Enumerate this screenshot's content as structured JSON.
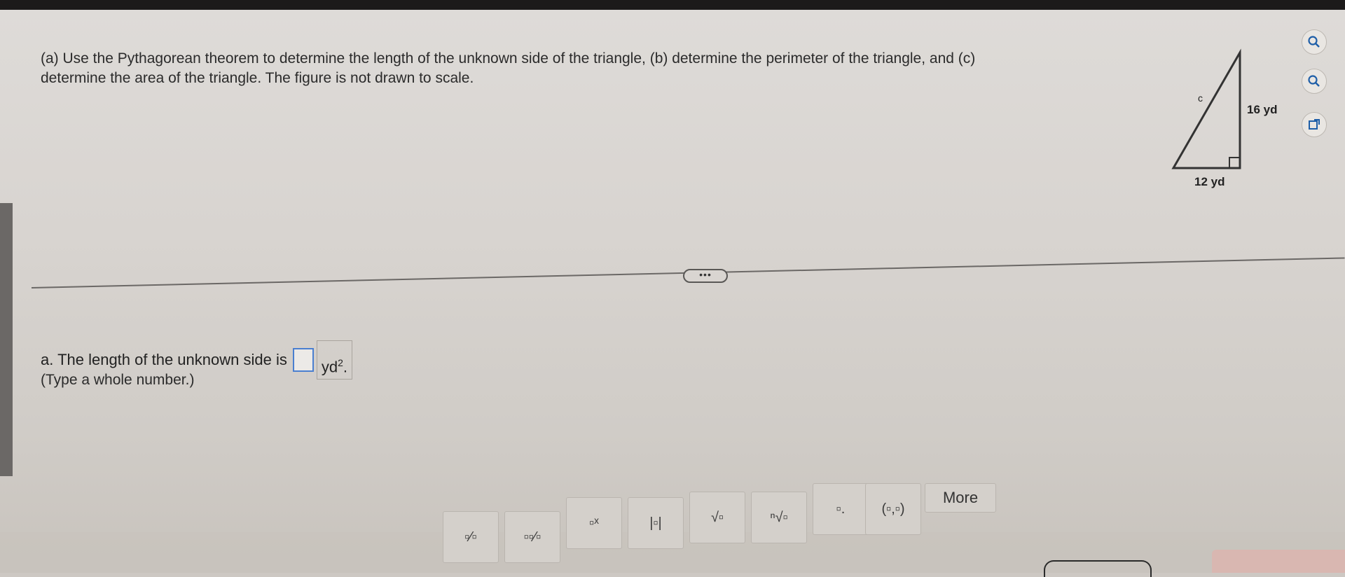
{
  "question": {
    "prompt_line1": "(a) Use the Pythagorean theorem to determine the length of the unknown side of the triangle, (b) determine the perimeter of the triangle, and (c)",
    "prompt_line2": "determine the area of the triangle. The figure is not drawn to scale."
  },
  "figure": {
    "label_hyp": "c",
    "label_vertical": "16 yd",
    "label_base": "12 yd"
  },
  "side_tools": [
    {
      "icon": "zoom-in-icon"
    },
    {
      "icon": "zoom-out-icon"
    },
    {
      "icon": "open-external-icon"
    }
  ],
  "expander": {
    "label": "•••"
  },
  "answer": {
    "prefix": "a. The length of the unknown side is",
    "input_value": "",
    "unit": "yd",
    "unit_exp": "2",
    "hint": "(Type a whole number.)"
  },
  "toolbar": {
    "tools": [
      {
        "name": "fraction-tool",
        "glyph": "▫⁄▫"
      },
      {
        "name": "mixed-number-tool",
        "glyph": "▫▫⁄▫"
      },
      {
        "name": "exponent-tool",
        "glyph": "▫ˣ"
      },
      {
        "name": "absolute-value-tool",
        "glyph": "|▫|"
      },
      {
        "name": "square-root-tool",
        "glyph": "√▫"
      },
      {
        "name": "nth-root-tool",
        "glyph": "ⁿ√▫"
      },
      {
        "name": "decimal-tool",
        "glyph": "▫."
      },
      {
        "name": "ordered-pair-tool",
        "glyph": "(▫,▫)"
      }
    ],
    "more_label": "More"
  }
}
